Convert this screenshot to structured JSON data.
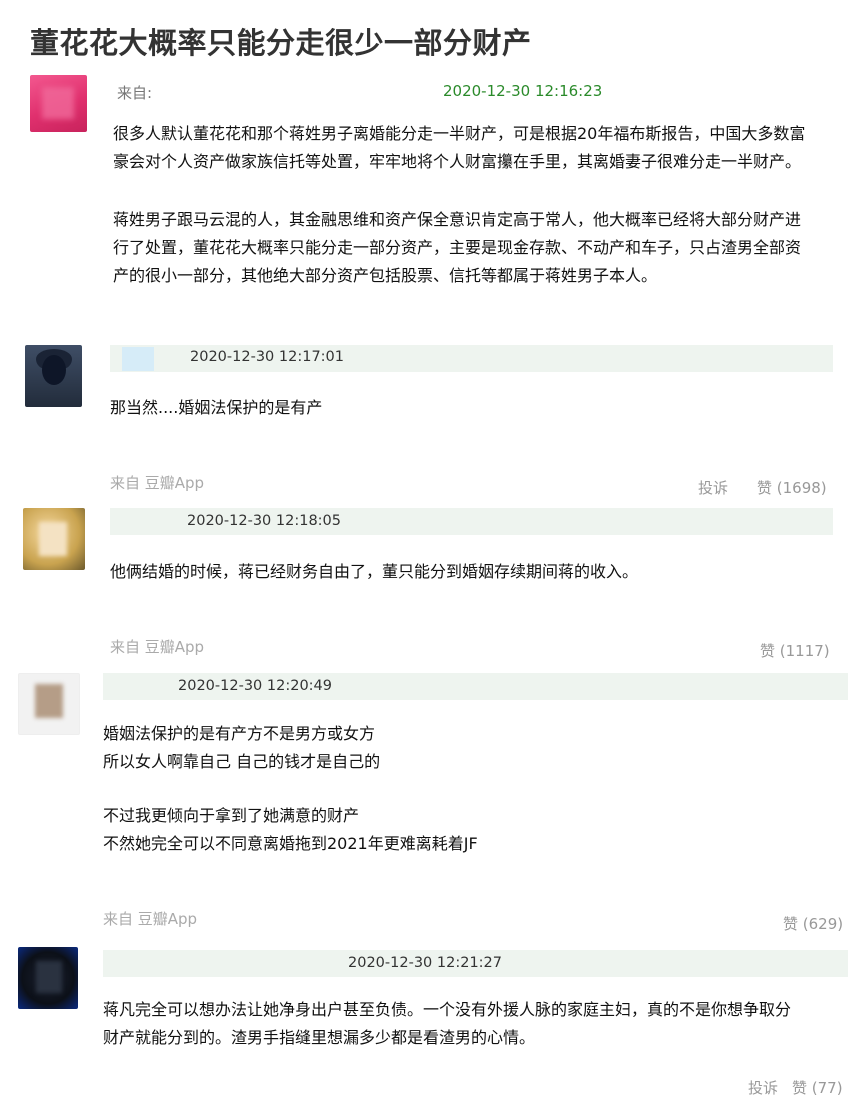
{
  "page_title": "董花花大概率只能分走很少一部分财产",
  "post": {
    "from_label": "来自:",
    "time": "2020-12-30 12:16:23",
    "para1_line1": "很多人默认董花花和那个蒋姓男子离婚能分走一半财产，可是根据20年福布斯报告，中国大多数富",
    "para1_line2": "豪会对个人资产做家族信托等处置，牢牢地将个人财富攥在手里，其离婚妻子很难分走一半财产。",
    "para2_line1": "蒋姓男子跟马云混的人，其金融思维和资产保全意识肯定高于常人，他大概率已经将大部分财产进",
    "para2_line2": "行了处置，董花花大概率只能分走一部分资产，主要是现金存款、不动产和车子，只占渣男全部资",
    "para2_line3": "产的很小一部分，其他绝大部分资产包括股票、信托等都属于蒋姓男子本人。"
  },
  "comments": [
    {
      "time": "2020-12-30 12:17:01",
      "lines": [
        "那当然....婚姻法保护的是有产"
      ],
      "from": "来自 豆瓣App",
      "report": "投诉",
      "like": "赞 (1698)"
    },
    {
      "time": "2020-12-30 12:18:05",
      "lines": [
        "他俩结婚的时候，蒋已经财务自由了，董只能分到婚姻存续期间蒋的收入。"
      ],
      "from": "来自 豆瓣App",
      "like": "赞 (1117)"
    },
    {
      "time": "2020-12-30 12:20:49",
      "lines": [
        "婚姻法保护的是有产方不是男方或女方",
        "所以女人啊靠自己 自己的钱才是自己的",
        "不过我更倾向于拿到了她满意的财产",
        "不然她完全可以不同意离婚拖到2021年更难离耗着JF"
      ],
      "from": "来自 豆瓣App",
      "like": "赞 (629)"
    },
    {
      "time": "2020-12-30 12:21:27",
      "lines": [
        "蒋凡完全可以想办法让她净身出户甚至负债。一个没有外援人脉的家庭主妇，真的不是你想争取分",
        "财产就能分到的。渣男手指缝里想漏多少都是看渣男的心情。"
      ],
      "report": "投诉",
      "like": "赞 (77)"
    }
  ],
  "colors": {
    "time_green": "#2a8a2a",
    "bar_bg": "#eef4ef",
    "from_gray": "#aaaaaa"
  },
  "icons": [
    "avatar-pink",
    "avatar-dark-silhouette",
    "avatar-golden",
    "avatar-light",
    "avatar-dark-blue"
  ]
}
